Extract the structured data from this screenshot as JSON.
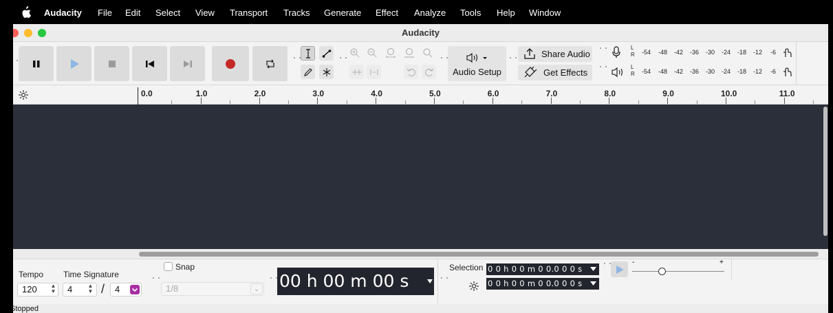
{
  "menubar": {
    "app_name": "Audacity",
    "items": [
      "File",
      "Edit",
      "Select",
      "View",
      "Transport",
      "Tracks",
      "Generate",
      "Effect",
      "Analyze",
      "Tools",
      "Help",
      "Window"
    ]
  },
  "window": {
    "title": "Audacity"
  },
  "toolbar": {
    "transport_icons": [
      "pause-icon",
      "play-icon",
      "stop-icon",
      "skip-to-start-icon",
      "skip-to-end-icon",
      "record-icon",
      "loop-icon"
    ],
    "tool_icons": [
      "selection-tool-icon",
      "envelope-tool-icon",
      "draw-tool-icon",
      "multi-tool-icon"
    ],
    "zoom_icons": [
      "zoom-in-icon",
      "zoom-out-icon",
      "fit-selection-icon",
      "fit-project-icon",
      "zoom-toggle-icon"
    ],
    "edit_icons": [
      "trim-icon",
      "silence-icon",
      "undo-icon",
      "redo-icon"
    ],
    "audio_setup_label": "Audio Setup",
    "share_audio_label": "Share Audio",
    "get_effects_label": "Get Effects",
    "meter_channels": {
      "left": "L",
      "right": "R"
    },
    "meter_scale": [
      "-54",
      "-48",
      "-42",
      "-36",
      "-30",
      "-24",
      "-18",
      "-12",
      "-6"
    ]
  },
  "ruler": {
    "labels": [
      "0.0",
      "1.0",
      "2.0",
      "3.0",
      "4.0",
      "5.0",
      "6.0",
      "7.0",
      "8.0",
      "9.0",
      "10.0",
      "11.0"
    ]
  },
  "bottom": {
    "tempo_label": "Tempo",
    "tempo_value": "120",
    "time_signature_label": "Time Signature",
    "time_sig_numerator": "4",
    "time_sig_separator": "/",
    "time_sig_denominator": "4",
    "snap_label": "Snap",
    "snap_value": "1/8",
    "time_display": "00 h 00 m 00 s",
    "selection_label": "Selection",
    "selection_start": "0 0 h 0 0 m 0 0.0 0 0 s",
    "selection_end": "0 0 h 0 0 m 0 0.0 0 0 s",
    "playback_speed": {
      "minus": "-",
      "plus": "+"
    }
  },
  "status": {
    "text": "Stopped"
  },
  "colors": {
    "track_area": "#2b2f3a",
    "record_red": "#c62828",
    "play_blue": "#8fb6e3",
    "time_display_bg": "#23252e"
  }
}
